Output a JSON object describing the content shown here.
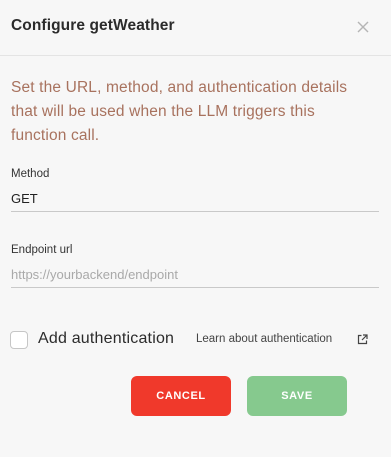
{
  "dialog": {
    "title": "Configure getWeather",
    "description": "Set the URL, method, and authentication details that will be used when the LLM triggers this function call."
  },
  "method": {
    "label": "Method",
    "value": "GET"
  },
  "endpoint": {
    "label": "Endpoint url",
    "placeholder": "https://yourbackend/endpoint",
    "value": ""
  },
  "auth": {
    "checkbox_label": "Add authentication",
    "checked": false,
    "learn_link": "Learn about authentication"
  },
  "buttons": {
    "cancel": "CANCEL",
    "save": "SAVE"
  },
  "colors": {
    "accent_text": "#a8725e",
    "cancel": "#f0392b",
    "save": "#86c98e"
  },
  "icons": {
    "close": "close-icon",
    "external": "external-link-icon"
  }
}
